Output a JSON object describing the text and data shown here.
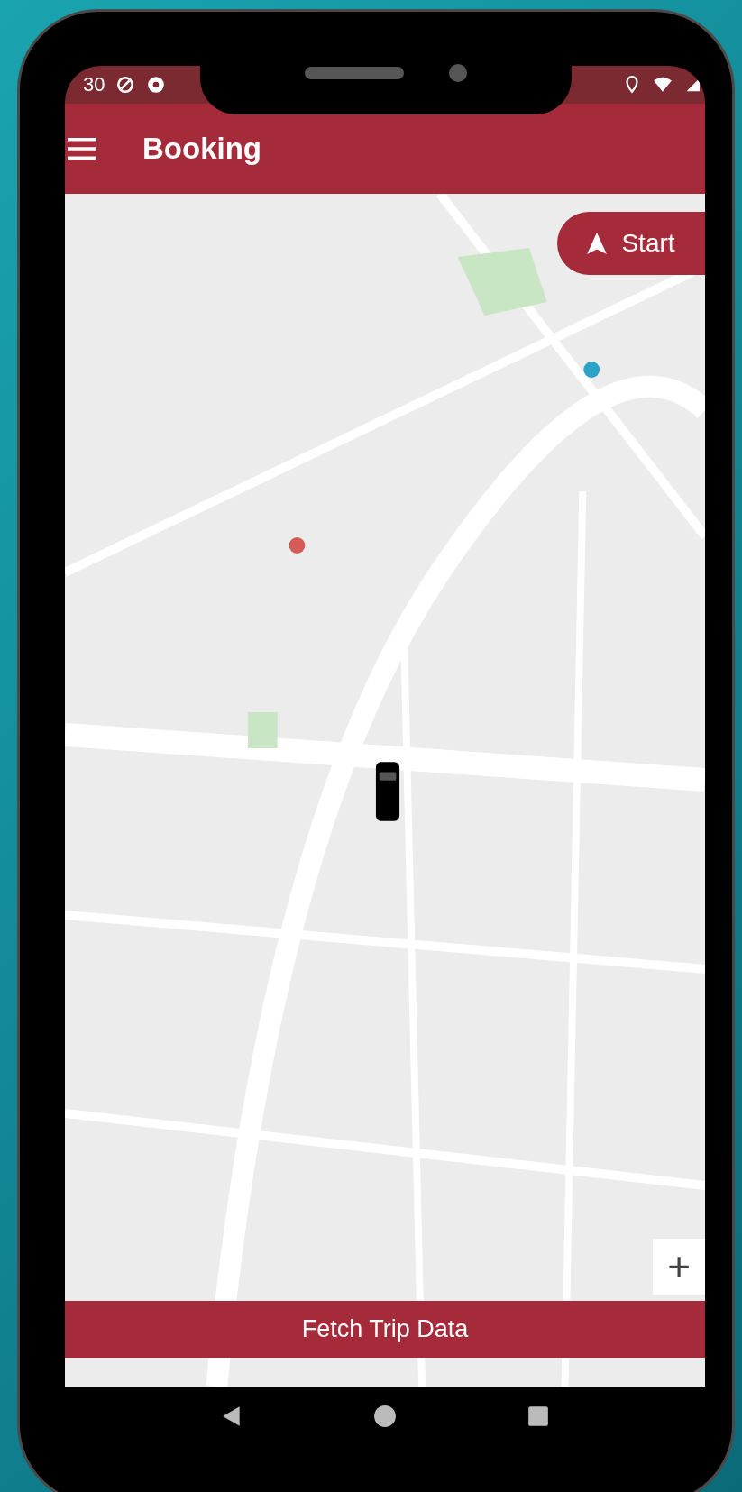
{
  "status_bar": {
    "time": "30"
  },
  "app_bar": {
    "title": "Booking"
  },
  "start_button": {
    "label": "Start"
  },
  "zoom_button": {
    "label": "+"
  },
  "fetch_button": {
    "label": "Fetch Trip Data"
  }
}
